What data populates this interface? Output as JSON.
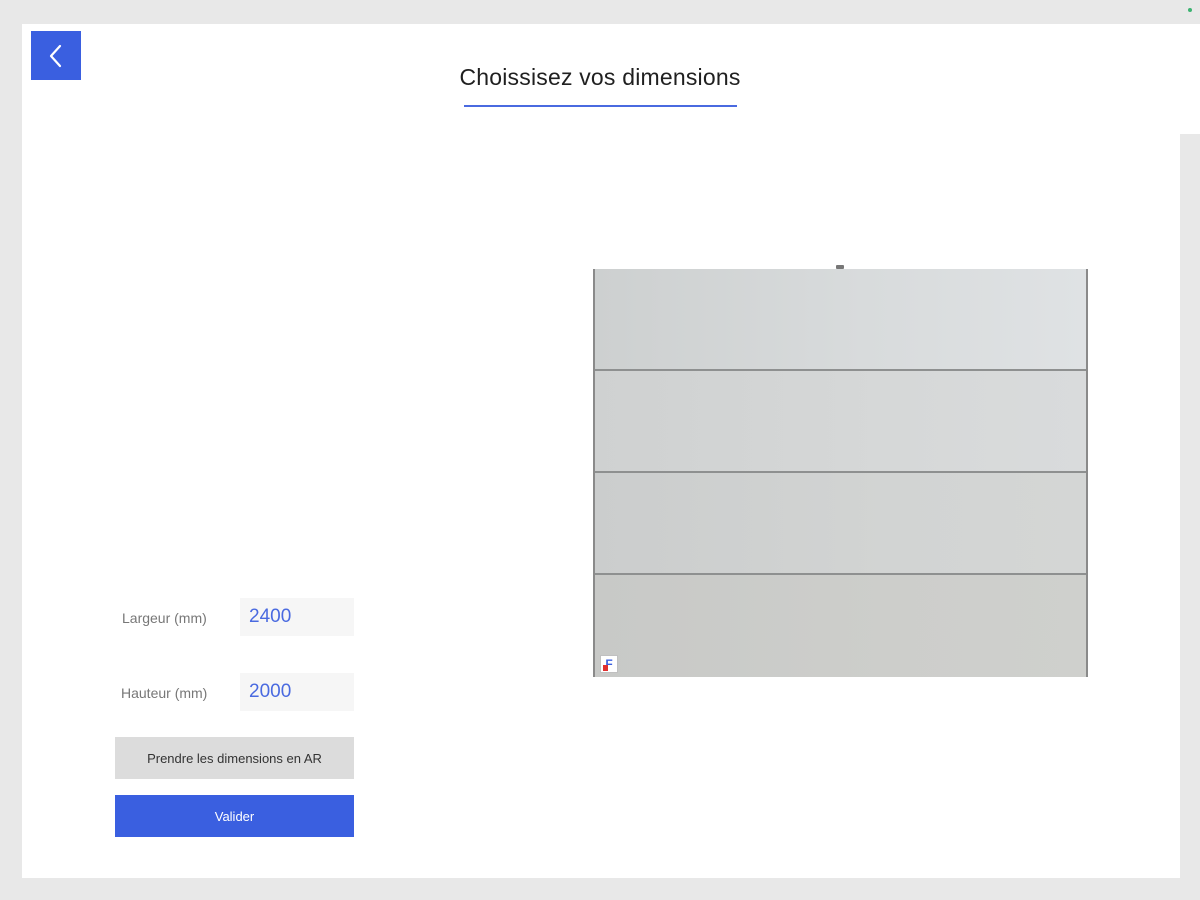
{
  "header": {
    "title": "Choissisez vos dimensions",
    "back_icon": "chevron-left-icon"
  },
  "form": {
    "width_label": "Largeur (mm)",
    "width_value": "2400",
    "height_label": "Hauteur (mm)",
    "height_value": "2000",
    "ar_button_label": "Prendre les dimensions en AR",
    "validate_button_label": "Valider"
  },
  "preview": {
    "panel_count": 4,
    "logo_text": "F"
  },
  "colors": {
    "accent": "#3a5fe0",
    "input_text": "#4a6ae0",
    "secondary_button": "#dcdcdc"
  }
}
